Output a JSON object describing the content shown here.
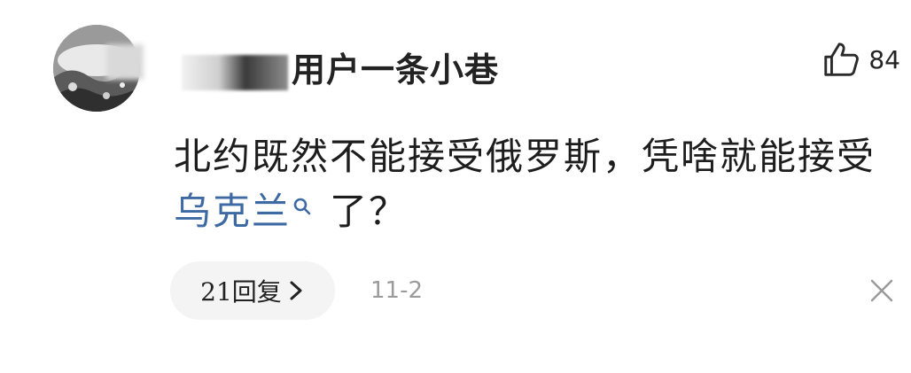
{
  "comment": {
    "username_visible": "一条小巷",
    "username_partial": "用户",
    "likes": "84",
    "text_before": "北约既然不能接受俄罗斯，凭啥就能接受",
    "linked_term": "乌克兰",
    "text_after": "了？",
    "reply_label": "21回复",
    "date": "11-2",
    "colors": {
      "text": "#1d1d1d",
      "link": "#3d6aa3",
      "date": "#9b9b9b",
      "pill_bg": "#f4f4f4"
    },
    "icons": [
      "avatar",
      "thumbs-up-icon",
      "search-icon",
      "chevron-right-icon",
      "close-icon"
    ]
  }
}
